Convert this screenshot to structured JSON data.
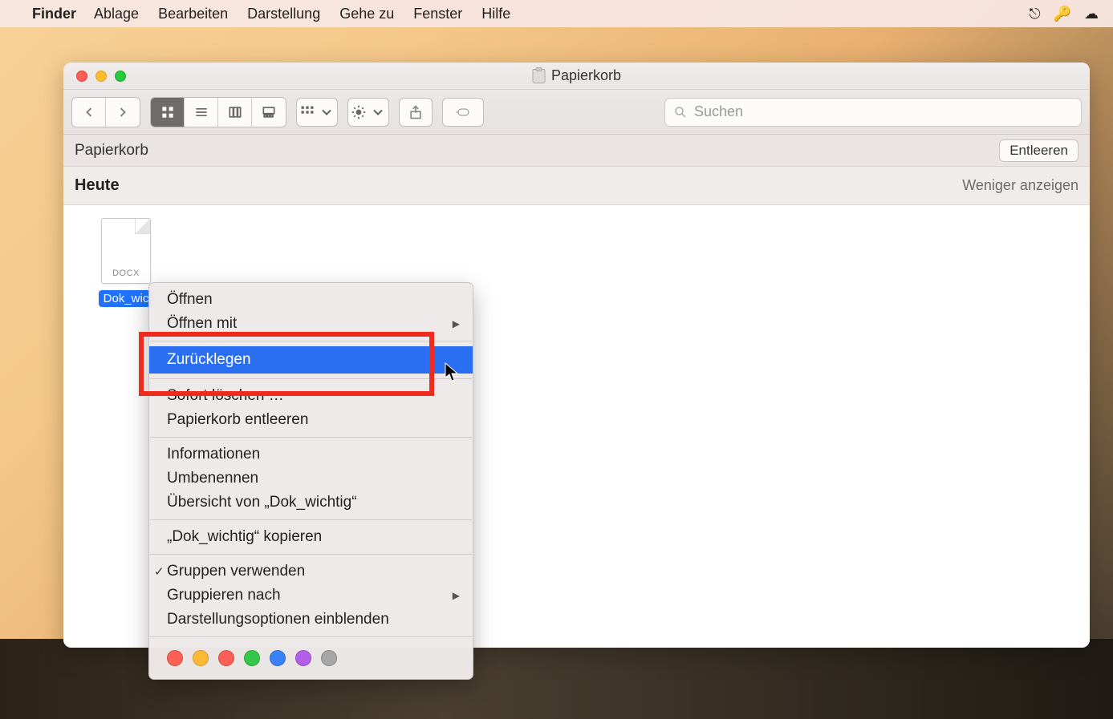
{
  "menubar": {
    "app": "Finder",
    "items": [
      "Ablage",
      "Bearbeiten",
      "Darstellung",
      "Gehe zu",
      "Fenster",
      "Hilfe"
    ]
  },
  "window": {
    "title": "Papierkorb",
    "location": "Papierkorb",
    "empty_button": "Entleeren",
    "search_placeholder": "Suchen",
    "group_label": "Heute",
    "show_less": "Weniger anzeigen"
  },
  "file": {
    "name": "Dok_wic",
    "ext": "DOCX"
  },
  "ctx": {
    "open": "Öffnen",
    "open_with": "Öffnen mit",
    "put_back": "Zurücklegen",
    "delete_now": "Sofort löschen …",
    "empty_trash": "Papierkorb entleeren",
    "info": "Informationen",
    "rename": "Umbenennen",
    "quicklook": "Übersicht von „Dok_wichtig“",
    "copy": "„Dok_wichtig“ kopieren",
    "use_groups": "Gruppen verwenden",
    "group_by": "Gruppieren nach",
    "view_options": "Darstellungsoptionen einblenden"
  },
  "tag_colors": [
    "#ff6055",
    "#ffb935",
    "#ff5f56",
    "#34c749",
    "#3a82f7",
    "#b35ee8",
    "#a6a6a6"
  ]
}
